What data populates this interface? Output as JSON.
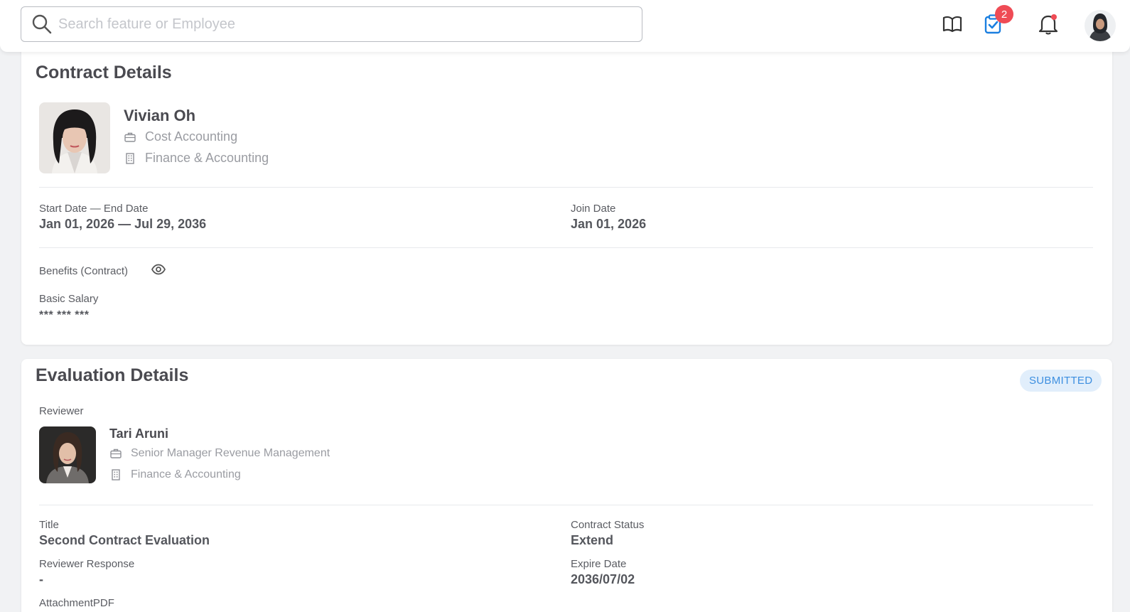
{
  "search": {
    "placeholder": "Search feature or Employee"
  },
  "header": {
    "task_badge_count": "2"
  },
  "contract": {
    "title": "Contract Details",
    "employee": {
      "name": "Vivian Oh",
      "position": "Cost Accounting",
      "department": "Finance & Accounting"
    },
    "start_end_label": "Start Date — End Date",
    "start_end_value": "Jan 01, 2026 — Jul 29, 2036",
    "join_label": "Join Date",
    "join_value": "Jan 01, 2026",
    "benefits_label": "Benefits (Contract)",
    "salary_label": "Basic Salary",
    "salary_value": "*** *** ***"
  },
  "evaluation": {
    "title": "Evaluation Details",
    "status": "SUBMITTED",
    "reviewer_label": "Reviewer",
    "reviewer": {
      "name": "Tari Aruni",
      "position": "Senior Manager Revenue Management",
      "department": "Finance & Accounting"
    },
    "title_label": "Title",
    "title_value": "Second Contract Evaluation",
    "contract_status_label": "Contract Status",
    "contract_status_value": "Extend",
    "response_label": "Reviewer Response",
    "response_value": "-",
    "expire_label": "Expire Date",
    "expire_value": "2036/07/02",
    "attachment_label": "AttachmentPDF"
  },
  "colors": {
    "accent": "#1b7fe0",
    "badge": "#ef4b55",
    "status_pill_bg": "#e1eefb",
    "status_pill_text": "#3d8fe0"
  }
}
